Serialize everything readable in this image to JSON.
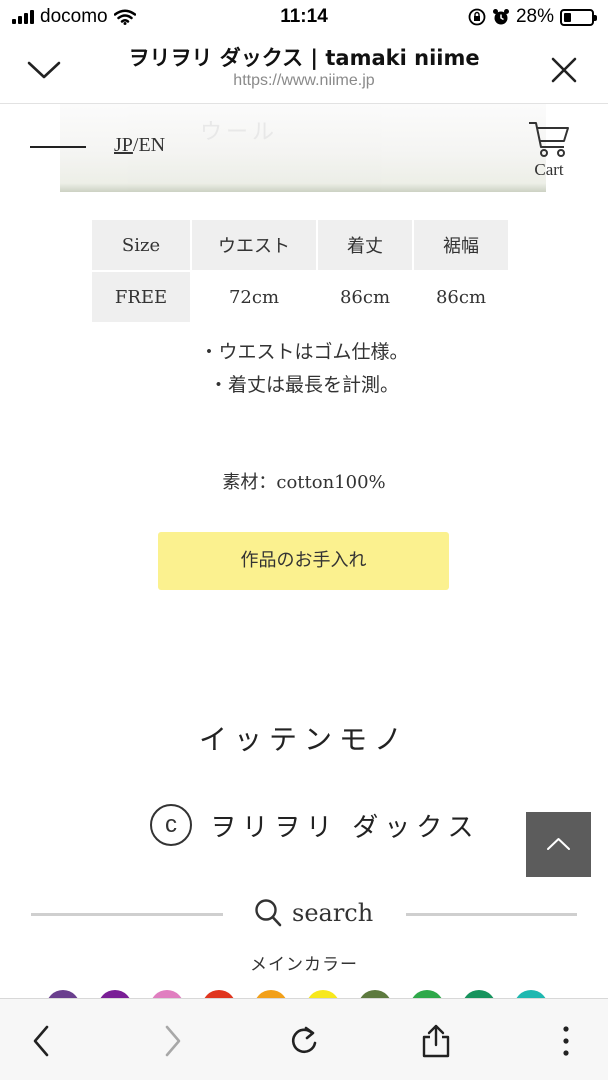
{
  "status_bar": {
    "carrier": "docomo",
    "time": "11:14",
    "battery": "28%",
    "battery_level": 0.28
  },
  "browser": {
    "title": "ヲリヲリ ダックス | tamaki niime",
    "url": "https://www.niime.jp",
    "collapse_icon": "chevron-down-icon",
    "close_icon": "close-icon"
  },
  "site_header": {
    "lang_jp": "JP",
    "lang_sep": "/",
    "lang_en": "EN",
    "cart_label": "Cart"
  },
  "size_table": {
    "headers": [
      "Size",
      "ウエスト",
      "着丈",
      "裾幅"
    ],
    "rows": [
      [
        "FREE",
        "72cm",
        "86cm",
        "86cm"
      ]
    ]
  },
  "notes": [
    "・ウエストはゴム仕様。",
    "・着丈は最長を計測。"
  ],
  "material": "素材：cotton100%",
  "care_button": "作品のお手入れ",
  "category": "イッテンモノ",
  "credit": {
    "symbol": "c",
    "name": "ヲリヲリ ダックス"
  },
  "search_label": "search",
  "main_color_label": "メインカラー",
  "colors": {
    "swatches": [
      "#6a3f8e",
      "#7a1f96",
      "#e07fc0",
      "#e0361f",
      "#f2a01a",
      "#f7e81d",
      "#5d7a3f",
      "#2fa84a",
      "#17935d",
      "#1fb8b0"
    ],
    "care_button_bg": "#fbf18f",
    "to_top_bg": "#5c5c5c"
  }
}
